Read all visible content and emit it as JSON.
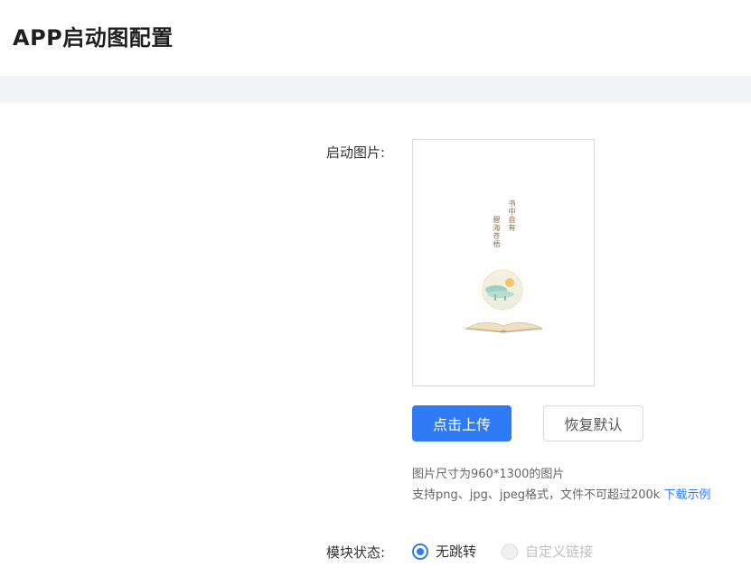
{
  "page": {
    "title": "APP启动图配置"
  },
  "form": {
    "image_label": "启动图片:",
    "status_label": "模块状态:"
  },
  "preview": {
    "poem_line_1": "书中自有",
    "poem_line_2": "碧海苍梧"
  },
  "buttons": {
    "upload_label": "点击上传",
    "reset_label": "恢复默认"
  },
  "hints": {
    "size_text": "图片尺寸为960*1300的图片",
    "format_text": "支持png、jpg、jpeg格式，文件不可超过200k ",
    "download_link": "下载示例"
  },
  "status": {
    "options": [
      {
        "label": "无跳转",
        "checked": true,
        "disabled": false
      },
      {
        "label": "自定义链接",
        "checked": false,
        "disabled": true
      }
    ]
  },
  "colors": {
    "primary": "#2f7bf6",
    "band": "#f3f4f7"
  }
}
